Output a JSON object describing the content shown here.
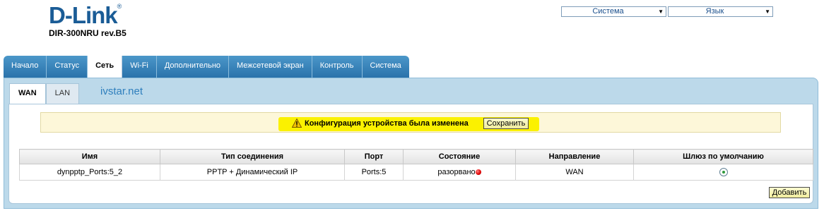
{
  "logo": {
    "text": "D-Link",
    "reg": "®",
    "model": "DIR-300NRU rev.B5"
  },
  "header": {
    "system_select": {
      "value": "Система"
    },
    "language_select": {
      "value": "Язык"
    }
  },
  "nav": {
    "tabs": [
      {
        "label": "Начало"
      },
      {
        "label": "Статус"
      },
      {
        "label": "Сеть",
        "active": true
      },
      {
        "label": "Wi-Fi"
      },
      {
        "label": "Дополнительно"
      },
      {
        "label": "Межсетевой экран"
      },
      {
        "label": "Контроль"
      },
      {
        "label": "Система"
      }
    ]
  },
  "subnav": {
    "tabs": [
      {
        "label": "WAN",
        "active": true
      },
      {
        "label": "LAN"
      }
    ],
    "site": "ivstar.net"
  },
  "notice": {
    "icon": "warning-icon",
    "text": "Конфигурация устройства была изменена",
    "save_label": "Сохранить"
  },
  "table": {
    "headers": [
      "Имя",
      "Тип соединения",
      "Порт",
      "Состояние",
      "Направление",
      "Шлюз по умолчанию"
    ],
    "rows": [
      {
        "name": "dynpptp_Ports:5_2",
        "type": "PPTP + Динамический IP",
        "port": "Ports:5",
        "status": "разорвано",
        "status_color": "#e00000",
        "direction": "WAN",
        "default_gateway": true
      }
    ]
  },
  "actions": {
    "add_label": "Добавить"
  },
  "colors": {
    "brand": "#1a5c96",
    "tab_bg": "#2a72ab",
    "panel_bg": "#bcd9ea",
    "highlight": "#fbf100"
  }
}
